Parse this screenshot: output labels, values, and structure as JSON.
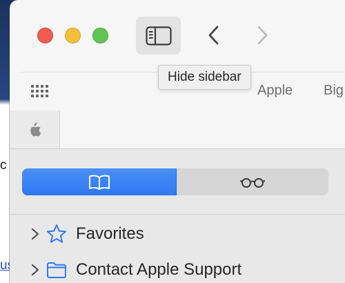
{
  "colors": {
    "accent": "#2f78f2",
    "icon_blue": "#2f78f2",
    "traffic_close": "#ee5d52",
    "traffic_minimize": "#f4be3f",
    "traffic_zoom": "#61c454"
  },
  "backdrop": {
    "fragment_1": "c",
    "fragment_2": "us"
  },
  "toolbar": {
    "sidebar_toggle_icon": "sidebar-icon",
    "back_icon": "chevron-left-icon",
    "forward_icon": "chevron-right-icon",
    "tooltip": "Hide sidebar"
  },
  "favorites_bar": {
    "grid_icon": "grid-icon",
    "items": [
      {
        "label": "Apple"
      },
      {
        "label": "Big"
      }
    ]
  },
  "tabs": [
    {
      "icon": "apple-logo-icon"
    }
  ],
  "sidebar": {
    "segments": [
      {
        "icon": "book-icon",
        "selected": true
      },
      {
        "icon": "reading-glasses-icon",
        "selected": false
      }
    ],
    "items": [
      {
        "label": "Favorites",
        "icon": "star-icon",
        "expanded": false
      },
      {
        "label": "Contact Apple Support",
        "icon": "folder-icon",
        "expanded": false
      }
    ]
  }
}
